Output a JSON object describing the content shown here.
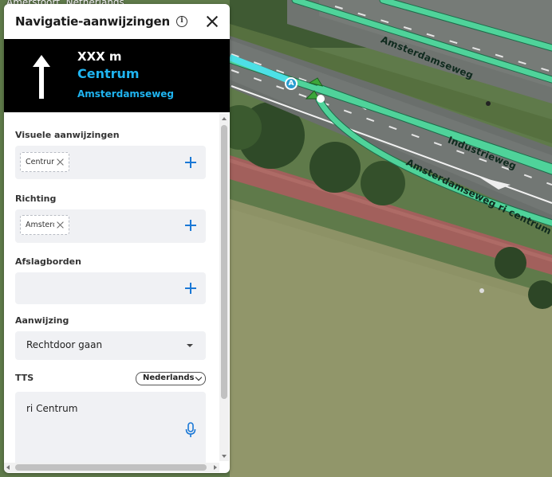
{
  "map": {
    "location_label": "Amersfoort, Netherlands",
    "road_labels": [
      "Amsterdamseweg",
      "Industrieweg",
      "Amsterdamseweg ri centrum"
    ],
    "marker_label": "A",
    "route_color": "#4fd39a"
  },
  "panel": {
    "title": "Navigatie-aanwijzingen",
    "info_icon": "i",
    "preview": {
      "distance": "XXX m",
      "direction": "Centrum",
      "street": "Amsterdamseweg"
    },
    "visual": {
      "label": "Visuele aanwijzingen",
      "chip": "Centrum"
    },
    "direction": {
      "label": "Richting",
      "chip": "Amsterdamseweg"
    },
    "exit_signs": {
      "label": "Afslagborden"
    },
    "instruction": {
      "label": "Aanwijzing",
      "value": "Rechtdoor gaan"
    },
    "tts": {
      "label": "TTS",
      "language": "Nederlands",
      "text": "ri Centrum"
    }
  }
}
